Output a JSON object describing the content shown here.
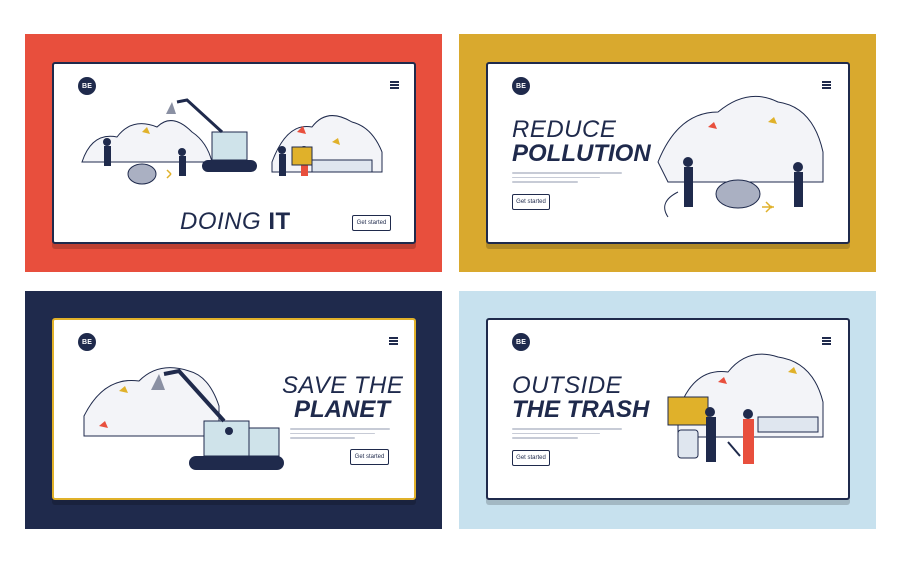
{
  "colors": {
    "red": "#e84f3d",
    "mustard": "#d9a92e",
    "navy": "#1f2a4c",
    "lightblue": "#c7e1ee",
    "yellow_border": "#e0b12a"
  },
  "logo_text": "BE",
  "panels": [
    {
      "title_light": "DOING",
      "title_bold": "IT",
      "button": "Get started"
    },
    {
      "title_light": "REDUCE",
      "title_bold": "POLLUTION",
      "button": "Get started"
    },
    {
      "title_light": "SAVE THE",
      "title_bold": "PLANET",
      "button": "Get started"
    },
    {
      "title_light": "OUTSIDE",
      "title_bold": "THE TRASH",
      "button": "Get started"
    }
  ],
  "icons": [
    "hamburger-menu-icon",
    "logo-icon"
  ]
}
